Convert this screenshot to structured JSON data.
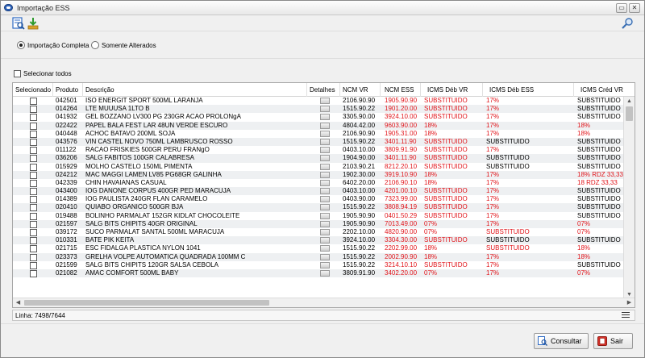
{
  "window": {
    "title": "Importação ESS",
    "minimize": "▭",
    "close": "✕"
  },
  "toolbar": {
    "icons": [
      "view-report-icon",
      "download-icon",
      "search-icon"
    ]
  },
  "mode": {
    "complete_label": "Importação Completa",
    "changed_label": "Somente Alterados",
    "selected": "complete"
  },
  "select_all_label": "Selecionar todos",
  "table": {
    "columns": [
      "Selecionado",
      "Produto",
      "Descrição",
      "Detalhes",
      "NCM VR",
      "NCM ESS",
      "ICMS Déb VR",
      "ICMS Déb ESS",
      "ICMS Créd VR"
    ],
    "rows": [
      [
        "042501",
        "ISO ENERGIT SPORT 500ML LARANJA",
        "2106.90.90",
        "1905.90.90",
        "SUBSTITUIDO",
        "17%",
        "SUBSTITUIDO"
      ],
      [
        "014264",
        "LTE MUUUSA 1LTO B",
        "1515.90.22",
        "1901.20.00",
        "SUBSTITUIDO",
        "17%",
        "SUBSTITUIDO"
      ],
      [
        "041932",
        "GEL BOZZANO LV300 PG 230GR ACAO PROLONgA",
        "3305.90.00",
        "3924.10.00",
        "SUBSTITUIDO",
        "17%",
        "SUBSTITUIDO"
      ],
      [
        "022422",
        "PAPEL BALA FEST LAR 48UN VERDE ESCURO",
        "4804.42.00",
        "9603.90.00",
        "18%",
        "17%",
        "18%"
      ],
      [
        "040448",
        "ACHOC BATAVO 200ML SOJA",
        "2106.90.90",
        "1905.31.00",
        "18%",
        "17%",
        "18%"
      ],
      [
        "043576",
        "VIN CASTEL NOVO 750ML LAMBRUSCO ROSSO",
        "1515.90.22",
        "3401.11.90",
        "SUBSTITUIDO",
        "SUBSTITUIDO",
        "SUBSTITUIDO"
      ],
      [
        "011122",
        "RACAO FRISKIES 500GR PERU FRANgO",
        "0403.10.00",
        "3809.91.90",
        "SUBSTITUIDO",
        "17%",
        "SUBSTITUIDO"
      ],
      [
        "036206",
        "SALG FABITOS 100GR CALABRESA",
        "1904.90.00",
        "3401.11.90",
        "SUBSTITUIDO",
        "SUBSTITUIDO",
        "SUBSTITUIDO"
      ],
      [
        "015929",
        "MOLHO CASTELO 150ML PIMENTA",
        "2103.90.21",
        "8212.20.10",
        "SUBSTITUIDO",
        "SUBSTITUIDO",
        "SUBSTITUIDO"
      ],
      [
        "024212",
        "MAC MAGGI LAMEN LV85 PG68GR GALINHA",
        "1902.30.00",
        "3919.10.90",
        "18%",
        "17%",
        "18% RDZ 33,33"
      ],
      [
        "042339",
        "CHIN HAVAIANAS CASUAL",
        "6402.20.00",
        "2106.90.10",
        "18%",
        "17%",
        "18 RDZ 33,33"
      ],
      [
        "043400",
        "IOG DANONE CORPUS 400GR PED MARACUJA",
        "0403.10.00",
        "4201.00.10",
        "SUBSTITUIDO",
        "17%",
        "SUBSTITUIDO"
      ],
      [
        "014389",
        "IOG PAULISTA 240GR FLAN CARAMELO",
        "0403.90.00",
        "7323.99.00",
        "SUBSTITUIDO",
        "17%",
        "SUBSTITUIDO"
      ],
      [
        "020410",
        "QUIABO ORGANICO 500GR BJA",
        "1515.90.22",
        "3808.94.19",
        "SUBSTITUIDO",
        "17%",
        "SUBSTITUIDO"
      ],
      [
        "019488",
        "BOLINHO PARMALAT 152GR KIDLAT CHOCOLEITE",
        "1905.90.90",
        "0401.50.29",
        "SUBSTITUIDO",
        "17%",
        "SUBSTITUIDO"
      ],
      [
        "021597",
        "SALG BITS CHIPITS 40GR ORIGINAL",
        "1905.90.90",
        "7013.49.00",
        "07%",
        "17%",
        "07%"
      ],
      [
        "039172",
        "SUCO PARMALAT SANTAL 500ML MARACUJA",
        "2202.10.00",
        "4820.90.00",
        "07%",
        "SUBSTITUIDO",
        "07%"
      ],
      [
        "010331",
        "BATE PIK KEITA",
        "3924.10.00",
        "3304.30.00",
        "SUBSTITUIDO",
        "SUBSTITUIDO",
        "SUBSTITUIDO"
      ],
      [
        "021715",
        "ESC FIDALGA PLASTICA NYLON 1041",
        "1515.90.22",
        "2202.99.00",
        "18%",
        "SUBSTITUIDO",
        "18%"
      ],
      [
        "023373",
        "GRELHA VOLPE AUTOMATICA QUADRADA 100MM C",
        "1515.90.22",
        "2002.90.90",
        "18%",
        "17%",
        "18%"
      ],
      [
        "021599",
        "SALG BITS CHIPITS 120GR SALSA CEBOLA",
        "1515.90.22",
        "3214.10.10",
        "SUBSTITUIDO",
        "17%",
        "SUBSTITUIDO"
      ],
      [
        "021082",
        "AMAC COMFORT 500ML BABY",
        "3809.91.90",
        "3402.20.00",
        "07%",
        "17%",
        "07%"
      ]
    ],
    "red_flags": [
      [
        1,
        1,
        1,
        0
      ],
      [
        1,
        1,
        1,
        0
      ],
      [
        1,
        1,
        1,
        0
      ],
      [
        1,
        1,
        1,
        1
      ],
      [
        1,
        1,
        1,
        1
      ],
      [
        1,
        1,
        0,
        0
      ],
      [
        1,
        1,
        1,
        0
      ],
      [
        1,
        1,
        0,
        0
      ],
      [
        1,
        1,
        0,
        0
      ],
      [
        1,
        1,
        1,
        1
      ],
      [
        1,
        1,
        1,
        1
      ],
      [
        1,
        1,
        1,
        0
      ],
      [
        1,
        1,
        1,
        0
      ],
      [
        1,
        1,
        1,
        0
      ],
      [
        1,
        1,
        1,
        0
      ],
      [
        1,
        1,
        1,
        1
      ],
      [
        1,
        1,
        1,
        1
      ],
      [
        1,
        1,
        0,
        0
      ],
      [
        1,
        1,
        1,
        1
      ],
      [
        1,
        1,
        1,
        1
      ],
      [
        1,
        1,
        1,
        0
      ],
      [
        1,
        1,
        1,
        1
      ]
    ]
  },
  "status": {
    "line_count": "Linha: 7498/7644"
  },
  "buttons": {
    "consult": "Consultar",
    "exit": "Sair"
  }
}
